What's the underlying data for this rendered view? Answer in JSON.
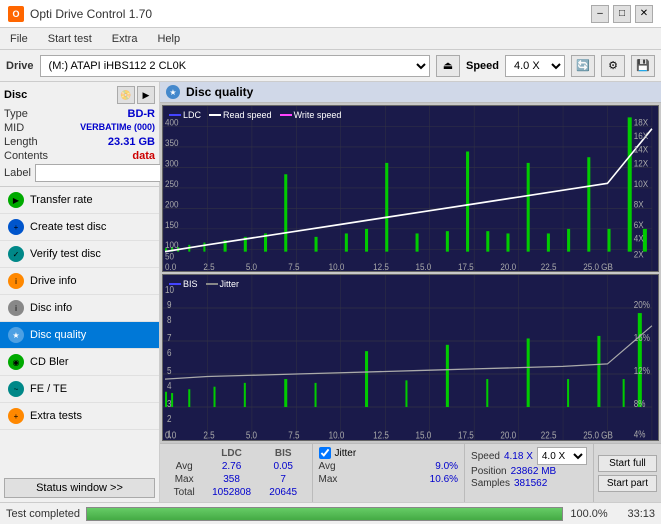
{
  "titlebar": {
    "icon_text": "O",
    "title": "Opti Drive Control 1.70",
    "min_btn": "–",
    "max_btn": "□",
    "close_btn": "✕"
  },
  "menubar": {
    "items": [
      "File",
      "Start test",
      "Extra",
      "Help"
    ]
  },
  "drivebar": {
    "label": "Drive",
    "drive_value": "(M:) ATAPI iHBS112  2 CL0K",
    "speed_label": "Speed",
    "speed_value": "4.0 X"
  },
  "disc": {
    "title": "Disc",
    "type_label": "Type",
    "type_value": "BD-R",
    "mid_label": "MID",
    "mid_value": "VERBATIMe (000)",
    "length_label": "Length",
    "length_value": "23.31 GB",
    "contents_label": "Contents",
    "contents_value": "data",
    "label_label": "Label"
  },
  "nav": {
    "items": [
      {
        "label": "Transfer rate",
        "icon_color": "green"
      },
      {
        "label": "Create test disc",
        "icon_color": "blue"
      },
      {
        "label": "Verify test disc",
        "icon_color": "teal"
      },
      {
        "label": "Drive info",
        "icon_color": "orange"
      },
      {
        "label": "Disc info",
        "icon_color": "gray"
      },
      {
        "label": "Disc quality",
        "icon_color": "blue",
        "active": true
      },
      {
        "label": "CD Bler",
        "icon_color": "green"
      },
      {
        "label": "FE / TE",
        "icon_color": "teal"
      },
      {
        "label": "Extra tests",
        "icon_color": "orange"
      }
    ],
    "status_btn": "Status window >>"
  },
  "disc_quality": {
    "title": "Disc quality",
    "chart1": {
      "legend": [
        {
          "label": "LDC",
          "color": "ldc"
        },
        {
          "label": "Read speed",
          "color": "read"
        },
        {
          "label": "Write speed",
          "color": "write"
        }
      ],
      "y_labels_right": [
        "18X",
        "16X",
        "14X",
        "12X",
        "10X",
        "8X",
        "6X",
        "4X",
        "2X"
      ],
      "y_labels_left": [
        "400",
        "350",
        "300",
        "250",
        "200",
        "150",
        "100",
        "50"
      ],
      "x_labels": [
        "0.0",
        "2.5",
        "5.0",
        "7.5",
        "10.0",
        "12.5",
        "15.0",
        "17.5",
        "20.0",
        "22.5",
        "25.0 GB"
      ]
    },
    "chart2": {
      "legend": [
        {
          "label": "BIS",
          "color": "bis"
        },
        {
          "label": "Jitter",
          "color": "jitter"
        }
      ],
      "y_labels_right": [
        "20%",
        "16%",
        "12%",
        "8%",
        "4%"
      ],
      "y_labels_left": [
        "10",
        "9",
        "8",
        "7",
        "6",
        "5",
        "4",
        "3",
        "2",
        "1"
      ],
      "x_labels": [
        "0.0",
        "2.5",
        "5.0",
        "7.5",
        "10.0",
        "12.5",
        "15.0",
        "17.5",
        "20.0",
        "22.5",
        "25.0 GB"
      ]
    }
  },
  "stats": {
    "ldc_label": "LDC",
    "bis_label": "BIS",
    "avg_label": "Avg",
    "avg_ldc": "2.76",
    "avg_bis": "0.05",
    "max_label": "Max",
    "max_ldc": "358",
    "max_bis": "7",
    "total_label": "Total",
    "total_ldc": "1052808",
    "total_bis": "20645",
    "jitter_checked": true,
    "jitter_label": "Jitter",
    "jitter_avg": "9.0%",
    "jitter_max": "10.6%",
    "speed_label": "Speed",
    "speed_val": "4.18 X",
    "speed_select": "4.0 X",
    "position_label": "Position",
    "position_val": "23862 MB",
    "samples_label": "Samples",
    "samples_val": "381562",
    "btn_start_full": "Start full",
    "btn_start_part": "Start part"
  },
  "progress": {
    "label": "Test completed",
    "percent": "100.0%",
    "time": "33:13"
  }
}
